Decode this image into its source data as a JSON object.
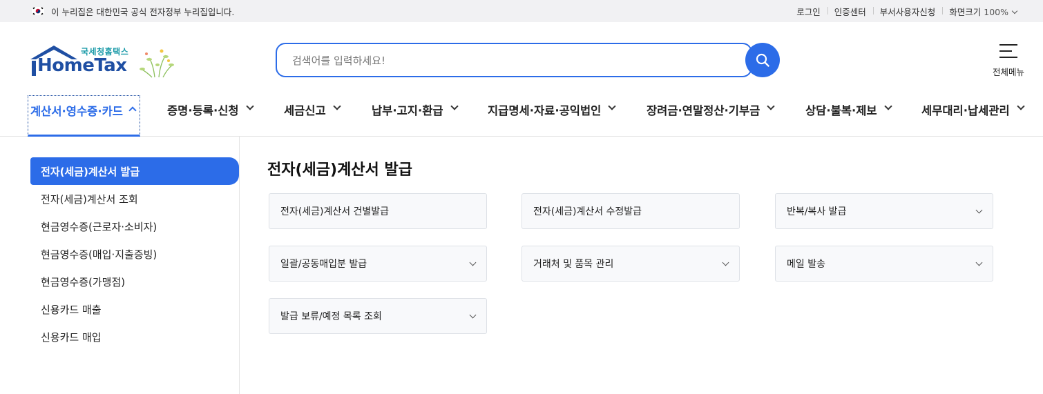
{
  "gov_bar": {
    "notice": "이 누리집은 대한민국 공식 전자정부 누리집입니다.",
    "links": [
      "로그인",
      "인증센터",
      "부서사용자신청",
      "화면크기"
    ],
    "zoom": "100%"
  },
  "logo": {
    "sub": "국세청홈택스",
    "main": "HomeTax"
  },
  "search": {
    "placeholder": "검색어를 입력하세요!"
  },
  "all_menu_label": "전체메뉴",
  "gnb": [
    "계산서·영수증·카드",
    "증명·등록·신청",
    "세금신고",
    "납부·고지·환급",
    "지급명세·자료·공익법인",
    "장려금·연말정산·기부금",
    "상담·불복·제보",
    "세무대리·납세관리"
  ],
  "sidebar": [
    "전자(세금)계산서 발급",
    "전자(세금)계산서 조회",
    "현금영수증(근로자·소비자)",
    "현금영수증(매입·지출증빙)",
    "현금영수증(가맹점)",
    "신용카드 매출",
    "신용카드 매입"
  ],
  "content": {
    "title": "전자(세금)계산서 발급",
    "cards": [
      "전자(세금)계산서 건별발급",
      "전자(세금)계산서 수정발급",
      "반복/복사 발급",
      "일괄/공동매입분 발급",
      "거래처 및 품목 관리",
      "메일 발송",
      "발급 보류/예정 목록 조회"
    ]
  },
  "colors": {
    "accent": "#2c6ce8",
    "brand": "#1f4fa3"
  }
}
